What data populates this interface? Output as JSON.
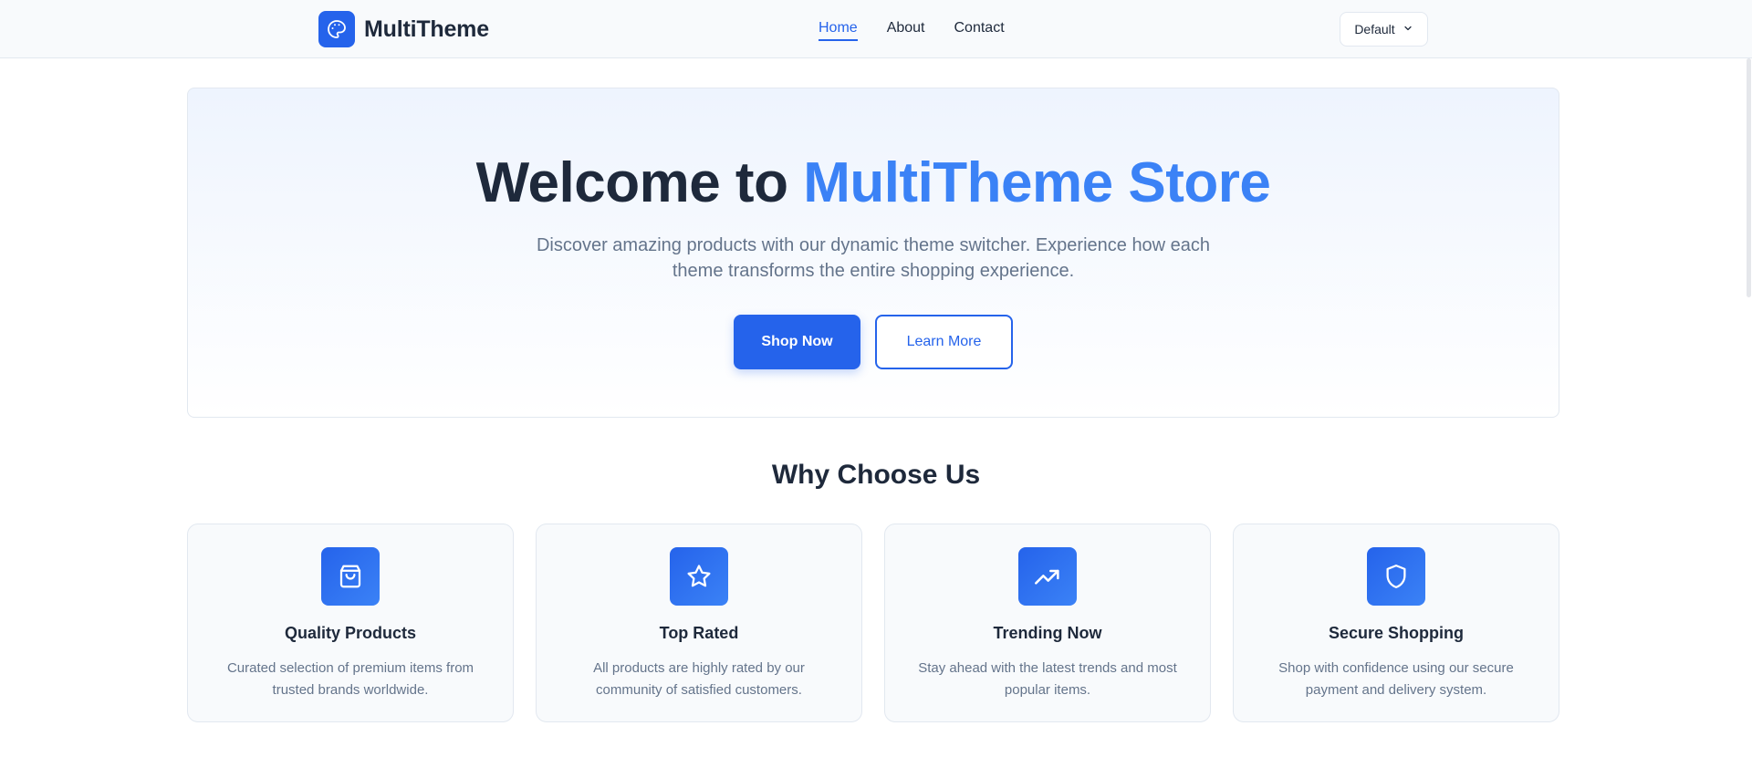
{
  "header": {
    "brand": "MultiTheme",
    "brand_icon": "palette-icon",
    "nav": [
      {
        "label": "Home",
        "active": true
      },
      {
        "label": "About",
        "active": false
      },
      {
        "label": "Contact",
        "active": false
      }
    ],
    "theme_select": {
      "value": "Default",
      "icon": "chevron-down-icon"
    }
  },
  "hero": {
    "title_prefix": "Welcome to ",
    "title_accent": "MultiTheme Store",
    "subtitle": "Discover amazing products with our dynamic theme switcher. Experience how each theme transforms the entire shopping experience.",
    "primary_button": "Shop Now",
    "secondary_button": "Learn More"
  },
  "features": {
    "title": "Why Choose Us",
    "items": [
      {
        "icon": "shopping-bag-icon",
        "title": "Quality Products",
        "description": "Curated selection of premium items from trusted brands worldwide."
      },
      {
        "icon": "star-icon",
        "title": "Top Rated",
        "description": "All products are highly rated by our community of satisfied customers."
      },
      {
        "icon": "trending-up-icon",
        "title": "Trending Now",
        "description": "Stay ahead with the latest trends and most popular items."
      },
      {
        "icon": "shield-icon",
        "title": "Secure Shopping",
        "description": "Shop with confidence using our secure payment and delivery system."
      }
    ]
  },
  "colors": {
    "primary": "#2563eb",
    "accent": "#3b82f6",
    "text": "#1e293b",
    "muted": "#64748b",
    "border": "#e2e8f0"
  }
}
